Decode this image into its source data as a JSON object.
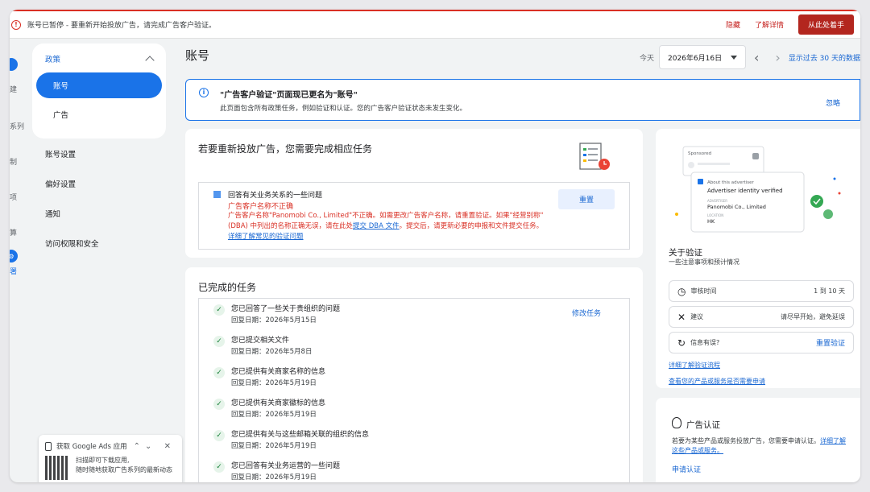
{
  "banner": {
    "message": "账号已暂停 - 要重新开始投放广告，请完成广告客户验证。",
    "hide": "隐藏",
    "learn_more": "了解详情",
    "start_here": "从此处着手"
  },
  "rail": {
    "items": [
      "建",
      "系列",
      "制",
      "项",
      "算",
      "署"
    ]
  },
  "sidebar": {
    "section_title": "政策",
    "items": [
      {
        "label": "账号",
        "active": true
      },
      {
        "label": "广告",
        "active": false
      }
    ],
    "links": [
      "账号设置",
      "偏好设置",
      "通知",
      "访问权限和安全"
    ]
  },
  "app_promo": {
    "title": "获取 Google Ads 应用",
    "line1": "扫描即可下载应用,",
    "line2": "随时随地获取广告系列的最新动态"
  },
  "header": {
    "title": "账号",
    "today": "今天",
    "date": "2026年6月16日",
    "range": "显示过去 30 天的数据"
  },
  "info_banner": {
    "title": "\"广告客户验证\"页面现已更名为\"账号\"",
    "text": "此页面包含所有政策任务，例如验证和认证。您的广告客户验证状态未发生变化。",
    "ignore": "忽略"
  },
  "task_card": {
    "title": "若要重新投放广告，您需要完成相应任务",
    "question": "回答有关业务关系的一些问题",
    "error_title": "广告客户名称不正确",
    "desc_1": "广告客户名称\"Panomobi Co., Limited\"不正确。如需更改广告客户名称，请重置验证。如果\"经营别称\"(DBA) 中列出的名称正确无误，请在此处",
    "desc_link": "提交 DBA 文件",
    "desc_2": "。提交后，请更新必要的申报和文件提交任务。",
    "desc_link2": "详细了解常见的验证问题",
    "reset": "重置"
  },
  "completed": {
    "title": "已完成的任务",
    "modify": "修改任务",
    "tasks": [
      {
        "title": "您已回答了一些关于贵组织的问题",
        "date": "回复日期：2026年5月15日"
      },
      {
        "title": "您已提交相关文件",
        "date": "回复日期：2026年5月8日"
      },
      {
        "title": "您已提供有关商家名称的信息",
        "date": "回复日期：2026年5月19日"
      },
      {
        "title": "您已提供有关商家徽标的信息",
        "date": "回复日期：2026年5月19日"
      },
      {
        "title": "您已提供有关与这些邮箱关联的组织的信息",
        "date": "回复日期：2026年5月19日"
      },
      {
        "title": "您已回答有关业务运营的一些问题",
        "date": "回复日期：2026年5月19日"
      }
    ]
  },
  "verify_card": {
    "hero": {
      "sponsored": "Sponsored",
      "about": "About this advertiser",
      "verified": "Advertiser identity verified",
      "advertiser_label": "ADVERTISER",
      "advertiser": "Panomobi Co., Limited",
      "location_label": "LOCATION",
      "location": "HK"
    },
    "title": "关于验证",
    "subtitle": "一些注意事项和预计情况",
    "rows": [
      {
        "icon": "clock-icon",
        "label": "审核时间",
        "value": "1 到 10 天"
      },
      {
        "icon": "tools-icon",
        "label": "建议",
        "value": "请尽早开始，避免延误"
      },
      {
        "icon": "refresh-icon",
        "label": "信息有误?",
        "value": "重置验证"
      }
    ],
    "link1": "详细了解验证流程",
    "link2": "查看您的产品或服务是否需要申请"
  },
  "cert_card": {
    "title": "广告认证",
    "text": "若要为某些产品或服务投放广告，您需要申请认证。",
    "link": "详细了解这些产品或服务。",
    "apply": "申请认证"
  }
}
